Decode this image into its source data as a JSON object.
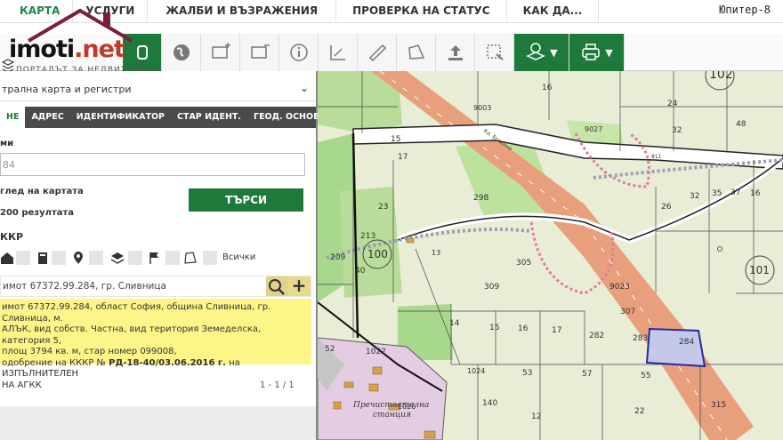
{
  "nav": {
    "items": [
      "КАРТА",
      "УСЛУГИ",
      "ЖАЛБИ И ВЪЗРАЖЕНИЯ",
      "ПРОВЕРКА НА СТАТУС",
      "КАК ДА..."
    ],
    "brand_right": "Юпитер-8"
  },
  "logo": {
    "text_main": "imoti",
    "text_dot": ".net",
    "subtitle": "ПОРТАЛЪТ ЗА НЕДВИЖИМИ И"
  },
  "panel": {
    "select_value": "трална карта и регистри",
    "tabs": [
      "НЕ",
      "АДРЕС",
      "ИДЕНТИФИКАТОР",
      "СТАР ИДЕНТ.",
      "ГЕОД. ОСНОВА"
    ],
    "field_label": "ми",
    "field_value": "84",
    "view_label": "глед на картата",
    "results_label": "200 резултата",
    "search_button": "ТЪРСИ",
    "section_title": "ККР",
    "all_label": "Всички",
    "result_title": "имот 67372.99.284, гр. Сливница",
    "result_lines": [
      "имот 67372.99.284, област София, община Сливница, гр. Сливница, м.",
      "АЛЪК, вид собств. Частна, вид територия Земеделска, категория 5,",
      "площ 3794 кв. м, стар номер 099008,",
      "одобрение на КККР № РД-18-40/03.06.2016 г. на ИЗПЪЛНИТЕЛЕН",
      "НА АГКК"
    ],
    "result_line4_plain1": "одобрение на КККР № ",
    "result_line4_bold": "РД-18-40/03.06.2016 г.",
    "result_line4_plain2": " на ИЗПЪЛНИТЕЛЕН",
    "pager": "1 - 1 / 1"
  },
  "map": {
    "parcel_numbers": [
      "16",
      "102",
      "24",
      "9003",
      "9027",
      "32",
      "48",
      "15",
      "17",
      "811",
      "298",
      "26",
      "32",
      "35",
      "37",
      "16",
      "23",
      "213",
      "100",
      "101",
      "209",
      "40",
      "13",
      "305",
      "309",
      "9023",
      "307",
      "14",
      "15",
      "16",
      "17",
      "282",
      "283",
      "284",
      "52",
      "1022",
      "1024",
      "53",
      "57",
      "55",
      "140",
      "315",
      "1026",
      "12",
      "22"
    ],
    "station_label_1": "Пречиствателна",
    "station_label_2": "станция",
    "road_label": "Кл. Ескелна"
  },
  "colors": {
    "accent": "#1d7a3a",
    "highlight": "#fdf588",
    "road": "#e8a07c",
    "selected_parcel": "#2a2a9a"
  }
}
